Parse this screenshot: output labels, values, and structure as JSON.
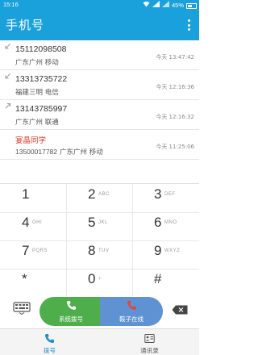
{
  "status_bar": {
    "time": "15:16",
    "battery": "45%"
  },
  "header": {
    "title": "手机号"
  },
  "call_log": [
    {
      "direction": "incoming",
      "number": "15112098508",
      "location": "广东广州 移动",
      "time": "今天 13:47:42",
      "highlight": false
    },
    {
      "direction": "incoming",
      "number": "13313735722",
      "location": "福建三明 电信",
      "time": "今天 12:16:36",
      "highlight": false
    },
    {
      "direction": "outgoing",
      "number": "13143785997",
      "location": "广东广州 联通",
      "time": "今天 12:16:32",
      "highlight": false
    },
    {
      "direction": "none",
      "number": "宴晶同学",
      "sub_number": "13500017782",
      "location": "广东广州 移动",
      "time": "今天 11:25:06",
      "highlight": true
    }
  ],
  "dialpad": [
    {
      "digit": "1",
      "letters": ""
    },
    {
      "digit": "2",
      "letters": "ABC"
    },
    {
      "digit": "3",
      "letters": "DEF"
    },
    {
      "digit": "4",
      "letters": "GHI"
    },
    {
      "digit": "5",
      "letters": "JKL"
    },
    {
      "digit": "6",
      "letters": "MNO"
    },
    {
      "digit": "7",
      "letters": "PQRS"
    },
    {
      "digit": "8",
      "letters": "TUV"
    },
    {
      "digit": "9",
      "letters": "WXYZ"
    },
    {
      "digit": "*",
      "letters": ""
    },
    {
      "digit": "0",
      "letters": "+"
    },
    {
      "digit": "#",
      "letters": ""
    }
  ],
  "controls": {
    "system_call": "系统拨号",
    "net_call": "鞍子在线"
  },
  "tabs": [
    {
      "label": "拨号",
      "icon": "phone-icon",
      "active": true
    },
    {
      "label": "通讯录",
      "icon": "contacts-icon",
      "active": false
    }
  ],
  "colors": {
    "accent": "#1aa1dc",
    "call_green": "#4fae4c",
    "call_blue": "#5e92d3",
    "highlight_red": "#e23b2e"
  }
}
